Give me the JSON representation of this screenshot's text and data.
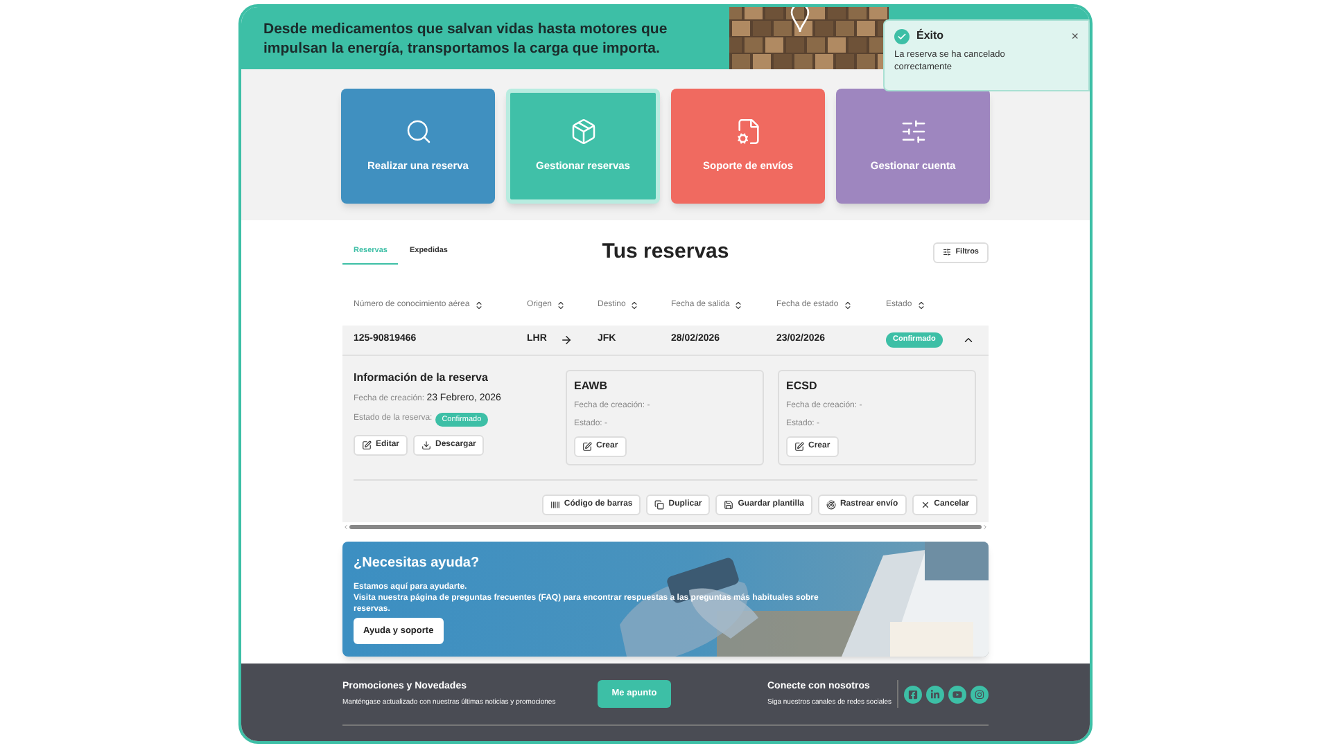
{
  "banner": {
    "text": "Desde medicamentos que salvan vidas hasta motores que impulsan la energía, transportamos la carga que importa."
  },
  "toast": {
    "title": "Éxito",
    "message": "La reserva se ha cancelado correctamente",
    "close": "×"
  },
  "tiles": [
    {
      "label": "Realizar una reserva",
      "kind": "search",
      "color": "#4090c0",
      "selected": false
    },
    {
      "label": "Gestionar reservas",
      "kind": "box",
      "color": "#40c0a8",
      "selected": true
    },
    {
      "label": "Soporte de envíos",
      "kind": "support",
      "color": "#f06a60",
      "selected": false
    },
    {
      "label": "Gestionar cuenta",
      "kind": "settings",
      "color": "#9e86bf",
      "selected": false
    }
  ],
  "tabs": [
    {
      "label": "Reservas",
      "selected": true
    },
    {
      "label": "Expedidas",
      "selected": false
    }
  ],
  "title": "Tus reservas",
  "filter_button": "Filtros",
  "table": {
    "columns": [
      "Número de conocimiento aérea",
      "Origen",
      "Destino",
      "Fecha de salida",
      "Fecha de estado",
      "Estado"
    ],
    "rows": [
      {
        "awb": "125-90819466",
        "origin": "LHR",
        "destination": "JFK",
        "departure": "28/02/2026",
        "status_date": "23/02/2026",
        "status": "Confirmado",
        "expanded": true
      }
    ]
  },
  "details": {
    "info": {
      "title": "Información de la reserva",
      "created_label": "Fecha de creación:",
      "created_value": "23 Febrero, 2026",
      "status_label": "Estado de la reserva:",
      "status_value": "Confirmado",
      "buttons": [
        {
          "label": "Editar",
          "kind": "edit"
        },
        {
          "label": "Descargar",
          "kind": "download"
        }
      ]
    },
    "documents": [
      {
        "title": "EAWB",
        "created": "Fecha de creación: -",
        "status": "Estado: -",
        "button": "Crear"
      },
      {
        "title": "ECSD",
        "created": "Fecha de creación: -",
        "status": "Estado: -",
        "button": "Crear"
      }
    ],
    "actions": [
      {
        "label": "Código de barras",
        "kind": "barcode"
      },
      {
        "label": "Duplicar",
        "kind": "duplicate"
      },
      {
        "label": "Guardar plantilla",
        "kind": "save"
      },
      {
        "label": "Rastrear envío",
        "kind": "track"
      },
      {
        "label": "Cancelar",
        "kind": "cancel"
      }
    ]
  },
  "help": {
    "title": "¿Necesitas ayuda?",
    "lines": [
      "Estamos aquí para ayudarte.",
      "Visita nuestra página de preguntas frecuentes (FAQ) para encontrar respuestas a las preguntas más habituales sobre reservas."
    ],
    "button": "Ayuda y soporte"
  },
  "footer": {
    "promo_title": "Promociones y Novedades",
    "promo_text": "Manténgase actualizado con nuestras últimas noticias y promociones",
    "button": "Me apunto",
    "connect_title": "Conecte con nosotros",
    "connect_text": "Siga nuestros canales de redes sociales",
    "socials": [
      {
        "kind": "facebook"
      },
      {
        "kind": "linkedin"
      },
      {
        "kind": "youtube"
      },
      {
        "kind": "instagram"
      }
    ]
  }
}
